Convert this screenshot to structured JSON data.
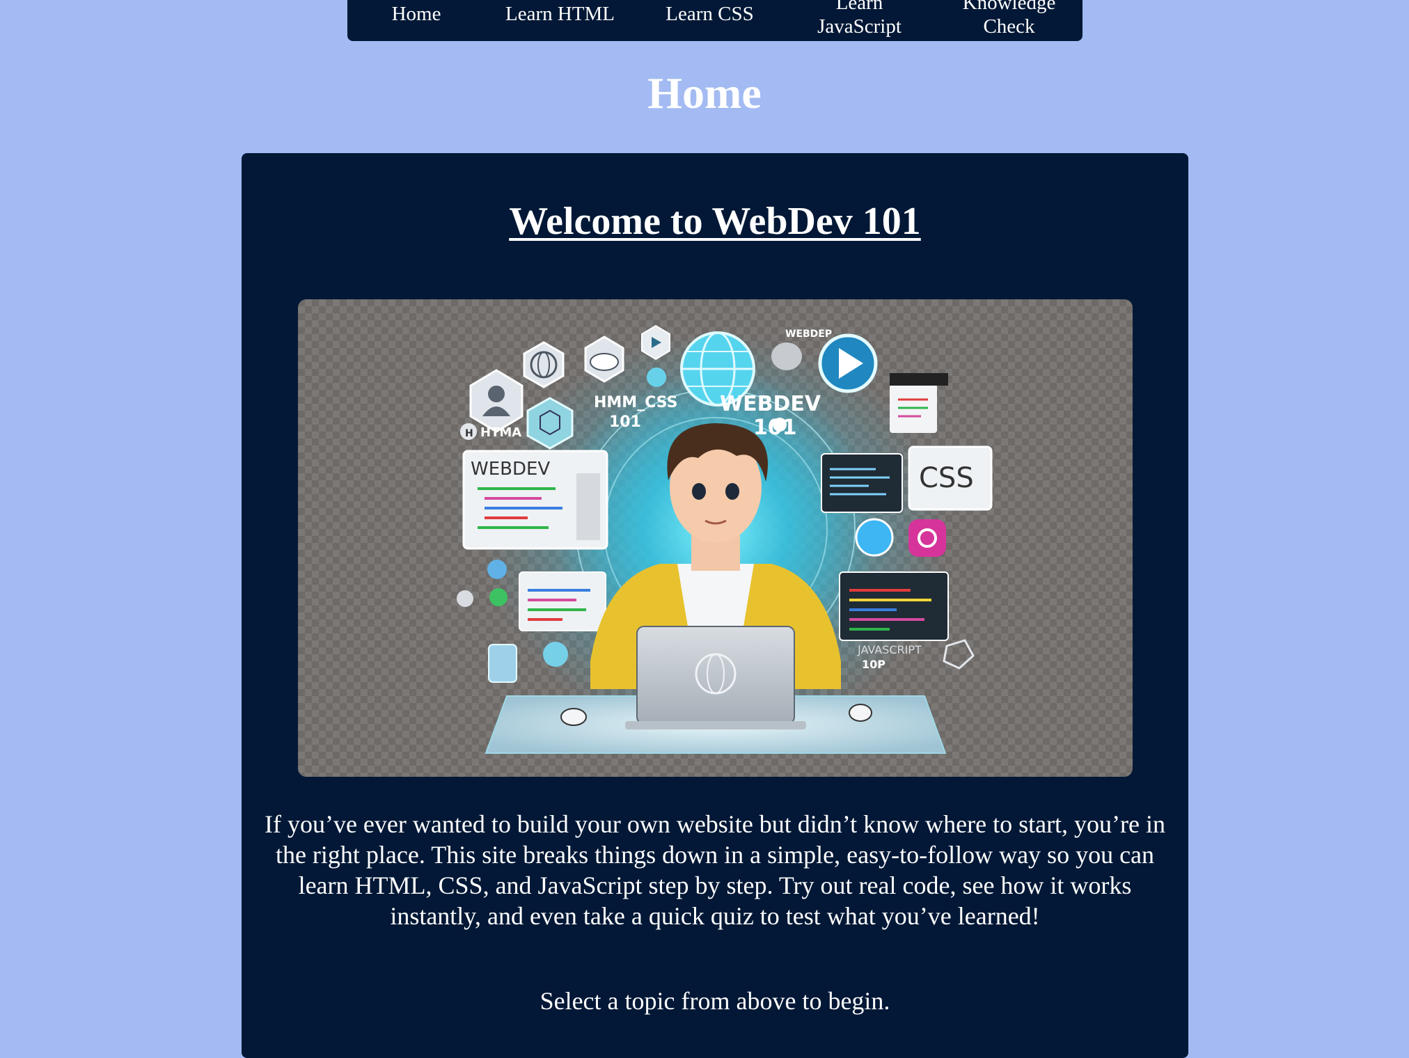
{
  "nav": {
    "items": [
      {
        "label": "Home"
      },
      {
        "label": "Learn HTML"
      },
      {
        "label": "Learn CSS"
      },
      {
        "label": "Learn\nJavaScript"
      },
      {
        "label": "Knowledge\nCheck"
      }
    ]
  },
  "page": {
    "title": "Home"
  },
  "main": {
    "heading": "Welcome to WebDev 101",
    "hero_image": {
      "labels": {
        "webdev_101": "WEBDEV\n101",
        "html_css_101": "HMM_CSS\n101",
        "webdev_panel": "WEBDEV",
        "css_panel": "CSS",
        "javascript": "JAVASCRIPT\n10P",
        "html_badge": "HTMA",
        "webdep": "WEBDEP"
      }
    },
    "intro": "If you’ve ever wanted to build your own website but didn’t know where to start, you’re in the right place. This site breaks things down in a simple, easy-to-follow way so you can learn HTML, CSS, and JavaScript step by step. Try out real code, see how it works instantly, and even take a quick quiz to test what you’ve learned!",
    "cta": "Select a topic from above to begin."
  },
  "colors": {
    "page_background": "#a3bbf2",
    "panel_background": "#021836",
    "text": "#ffffff"
  }
}
